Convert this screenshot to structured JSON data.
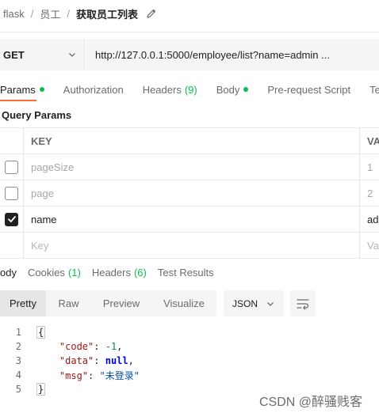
{
  "breadcrumb": {
    "items": [
      "flask",
      "员工"
    ],
    "separator": "/",
    "current": "获取员工列表"
  },
  "request": {
    "method": "GET",
    "url": "http://127.0.0.1:5000/employee/list?name=admin ..."
  },
  "request_tabs": [
    {
      "label": "Params",
      "indicator": "dot",
      "active": true
    },
    {
      "label": "Authorization"
    },
    {
      "label": "Headers",
      "count": "(9)"
    },
    {
      "label": "Body",
      "indicator": "dot"
    },
    {
      "label": "Pre-request Script"
    },
    {
      "label": "Tes"
    }
  ],
  "query_params": {
    "title": "Query Params",
    "headers": {
      "key": "KEY",
      "value": "VA"
    },
    "rows": [
      {
        "key": "pageSize",
        "value": "1",
        "checked": false
      },
      {
        "key": "page",
        "value": "2",
        "checked": false
      },
      {
        "key": "name",
        "value": "ad",
        "checked": true
      }
    ],
    "new_row": {
      "key_placeholder": "Key",
      "value_placeholder": "Va"
    }
  },
  "response_tabs": [
    {
      "label": "ody",
      "active": true
    },
    {
      "label": "Cookies",
      "count": "(1)"
    },
    {
      "label": "Headers",
      "count": "(6)"
    },
    {
      "label": "Test Results"
    }
  ],
  "response_toolbar": {
    "views": [
      "Pretty",
      "Raw",
      "Preview",
      "Visualize"
    ],
    "active_view": "Pretty",
    "format": "JSON"
  },
  "response_body": {
    "line_numbers": [
      "1",
      "2",
      "3",
      "4",
      "5"
    ],
    "open_brace": "{",
    "close_brace": "}",
    "fields": [
      {
        "key": "\"code\"",
        "value": "-1",
        "type": "number",
        "trailer": ","
      },
      {
        "key": "\"data\"",
        "value": "null",
        "type": "null",
        "trailer": ","
      },
      {
        "key": "\"msg\"",
        "value": "\"未登录\"",
        "type": "string",
        "trailer": ""
      }
    ]
  },
  "watermark": "CSDN @醉骚贱客",
  "colors": {
    "accent": "#ff6c37",
    "indicator": "#0cbb52",
    "panel": "#f5f5f5",
    "border": "#e6e6e6"
  }
}
